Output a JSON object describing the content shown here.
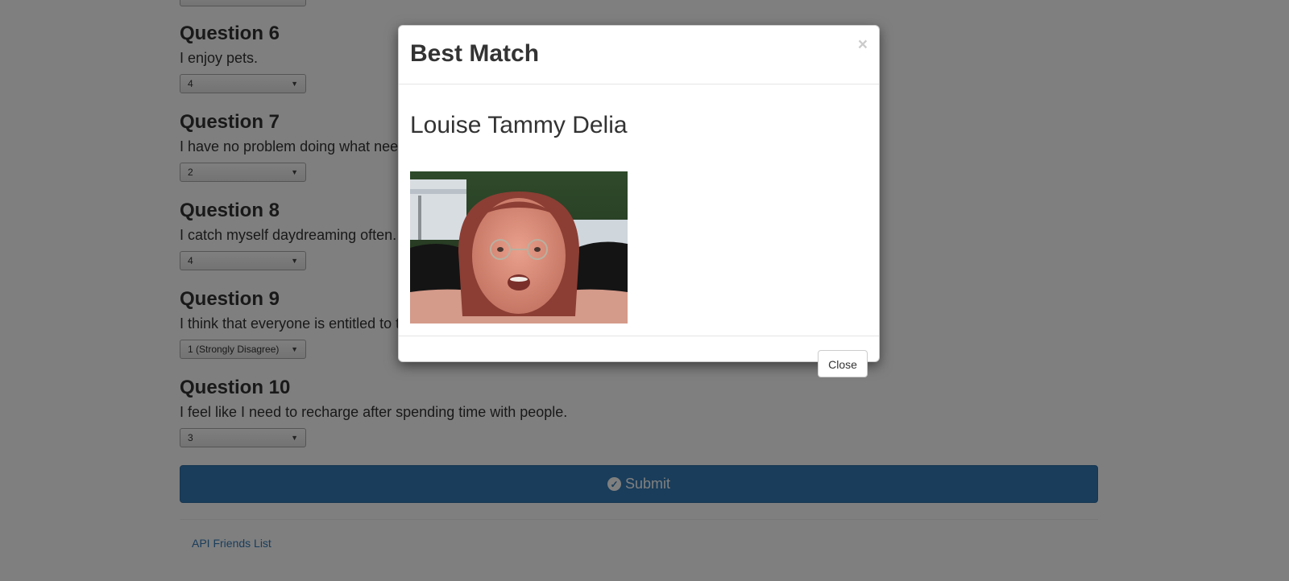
{
  "questions": [
    {
      "title": "Question 6",
      "text": "I enjoy pets.",
      "selected": "4"
    },
    {
      "title": "Question 7",
      "text": "I have no problem doing what needs to be done.",
      "selected": "2"
    },
    {
      "title": "Question 8",
      "text": "I catch myself daydreaming often.",
      "selected": "4"
    },
    {
      "title": "Question 9",
      "text": "I think that everyone is entitled to their own opinion.",
      "selected": "1 (Strongly Disagree)"
    },
    {
      "title": "Question 10",
      "text": "I feel like I need to recharge after spending time with people.",
      "selected": "3"
    }
  ],
  "submit": {
    "label": "Submit",
    "icon": "check-circle-icon",
    "color": "#337ab7"
  },
  "footer": {
    "link_label": "API Friends List"
  },
  "modal": {
    "title": "Best Match",
    "close_x": "×",
    "match_name": "Louise Tammy Delia",
    "close_label": "Close"
  },
  "colors": {
    "backdrop": "rgba(0,0,0,0.5)",
    "primary": "#337ab7",
    "link": "#337ab7"
  }
}
